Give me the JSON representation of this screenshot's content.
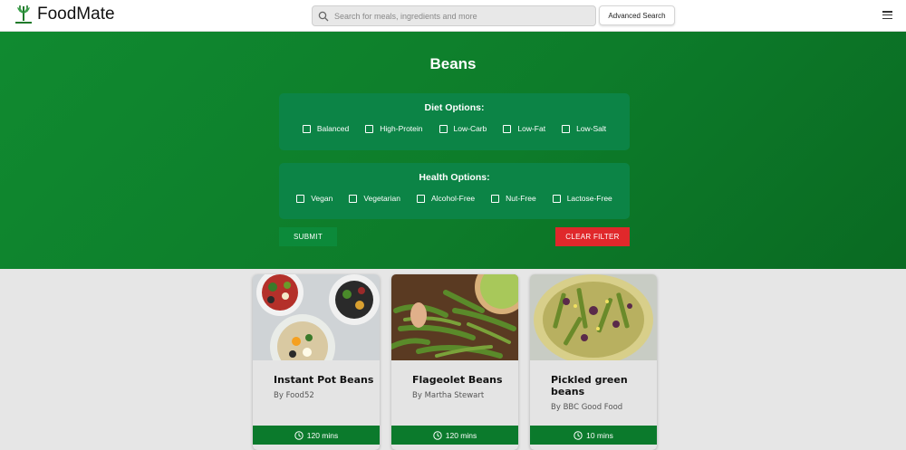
{
  "header": {
    "logo_text": "FoodMate",
    "search_placeholder": "Search for meals, ingredients and more",
    "advanced_label": "Advanced Search"
  },
  "hero": {
    "title": "Beans",
    "diet": {
      "title": "Diet Options:",
      "options": [
        "Balanced",
        "High-Protein",
        "Low-Carb",
        "Low-Fat",
        "Low-Salt"
      ]
    },
    "health": {
      "title": "Health Options:",
      "options": [
        "Vegan",
        "Vegetarian",
        "Alcohol-Free",
        "Nut-Free",
        "Lactose-Free"
      ]
    },
    "submit_label": "SUBMIT",
    "clear_label": "CLEAR FILTER"
  },
  "cards": [
    {
      "title": "Instant Pot Beans",
      "by": "By Food52",
      "time": "120 mins",
      "image": "bean-salad-plates-photo"
    },
    {
      "title": "Flageolet Beans",
      "by": "By Martha Stewart",
      "time": "120 mins",
      "image": "green-bean-pods-photo"
    },
    {
      "title": "Pickled green beans",
      "by": "By BBC Good Food",
      "time": "10 mins",
      "image": "pickle-jar-photo"
    }
  ],
  "colors": {
    "brand_green": "#0d7c2a",
    "panel_green": "#0c8446",
    "clear_red": "#e0282b"
  }
}
